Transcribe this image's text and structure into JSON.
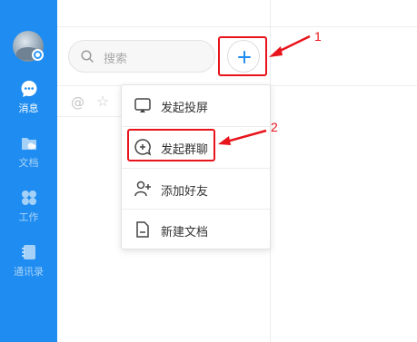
{
  "sidebar": {
    "items": [
      {
        "label": "消息",
        "icon": "chat-bubble-icon",
        "active": true
      },
      {
        "label": "文档",
        "icon": "cloud-folder-icon",
        "active": false
      },
      {
        "label": "工作",
        "icon": "grid-apps-icon",
        "active": false
      },
      {
        "label": "通讯录",
        "icon": "contacts-book-icon",
        "active": false
      }
    ]
  },
  "search": {
    "placeholder": "搜索"
  },
  "add_button": {
    "icon": "plus-icon"
  },
  "menu": {
    "items": [
      {
        "label": "发起投屏",
        "icon": "screen-cast-icon"
      },
      {
        "label": "发起群聊",
        "icon": "group-chat-icon"
      },
      {
        "label": "添加好友",
        "icon": "add-friend-icon"
      },
      {
        "label": "新建文档",
        "icon": "new-document-icon"
      }
    ]
  },
  "annotations": {
    "step1": "1",
    "step2": "2",
    "color": "#e8141c"
  },
  "colors": {
    "sidebar": "#1e8cf0",
    "accent": "#1e8cf0",
    "annotation": "#e8141c"
  }
}
